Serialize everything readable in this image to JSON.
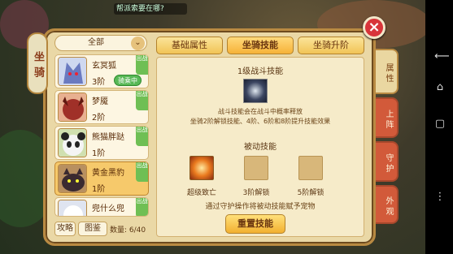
{
  "ticker": "帮派索要在哪?",
  "side_title": "坐骑",
  "close_label": "×",
  "filter": {
    "selected": "全部",
    "chevron": "⌄"
  },
  "mounts": [
    {
      "name": "玄冥狐",
      "level": "3阶",
      "tag": "出战",
      "riding": "骑乘中",
      "avatar_color": "#6a7ac0"
    },
    {
      "name": "梦魇",
      "level": "2阶",
      "tag": "出战",
      "riding": "",
      "avatar_color": "#a03028"
    },
    {
      "name": "熊猫胖跶",
      "level": "1阶",
      "tag": "出战",
      "riding": "",
      "avatar_color": "#f0f0f0"
    },
    {
      "name": "黄金黑豹",
      "level": "1阶",
      "tag": "出战",
      "riding": "",
      "avatar_color": "#3a2a30"
    },
    {
      "name": "兜什么兜",
      "level": "",
      "tag": "出战",
      "riding": "",
      "avatar_color": "#e8e8f0"
    }
  ],
  "footer": {
    "strategy": "攻略",
    "guide": "图鉴",
    "count_label": "数量: 6/40"
  },
  "tabs": [
    "基础属性",
    "坐骑技能",
    "坐骑升阶"
  ],
  "active_tab": "坐骑技能",
  "content": {
    "level1_title": "1级战斗技能",
    "desc_line1": "战斗技能会在战斗中概率释放",
    "desc_line2": "坐骑2阶解锁技能、4阶、6阶和8阶提升技能效果",
    "passive_title": "被动技能",
    "slots": [
      "超级致亡",
      "3阶解锁",
      "5阶解锁"
    ],
    "note": "通过守护操作将被动技能赋予宠物",
    "reset_label": "重置技能"
  },
  "right_tabs": [
    "属性",
    "上阵",
    "守护",
    "外观"
  ],
  "android_nav": [
    "⟵",
    "⌂",
    "▢",
    "⋮"
  ],
  "colors": {
    "panel": "#ead8a6",
    "accent": "#f2b030",
    "close": "#d8343a"
  }
}
